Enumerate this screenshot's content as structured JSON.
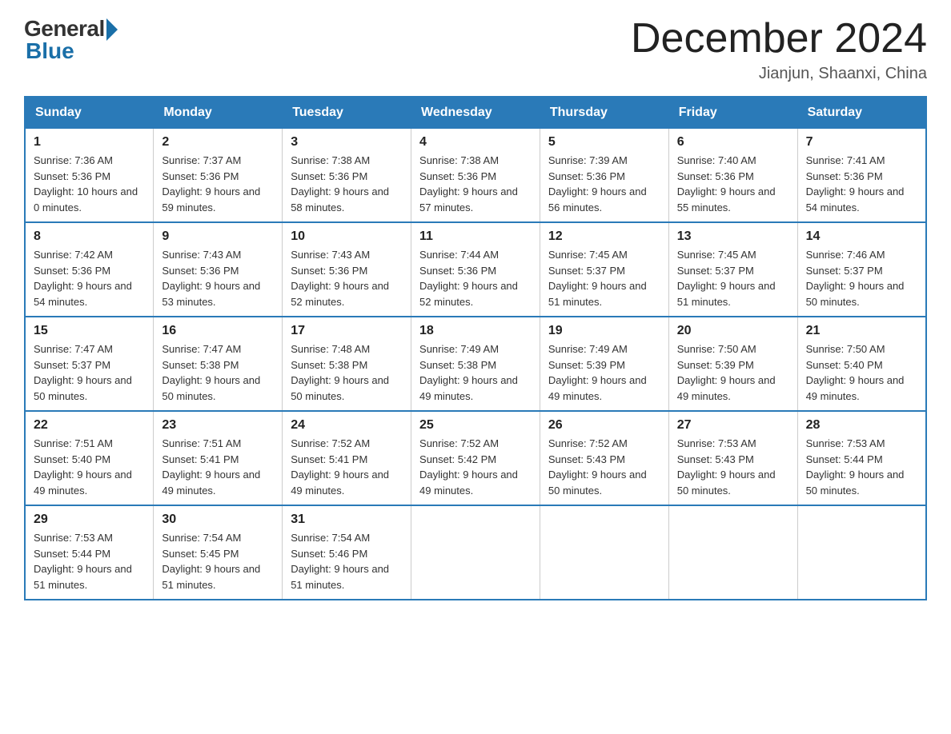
{
  "header": {
    "logo_general": "General",
    "logo_blue": "Blue",
    "month_title": "December 2024",
    "location": "Jianjun, Shaanxi, China"
  },
  "weekdays": [
    "Sunday",
    "Monday",
    "Tuesday",
    "Wednesday",
    "Thursday",
    "Friday",
    "Saturday"
  ],
  "weeks": [
    [
      {
        "day": "1",
        "sunrise": "7:36 AM",
        "sunset": "5:36 PM",
        "daylight": "10 hours and 0 minutes."
      },
      {
        "day": "2",
        "sunrise": "7:37 AM",
        "sunset": "5:36 PM",
        "daylight": "9 hours and 59 minutes."
      },
      {
        "day": "3",
        "sunrise": "7:38 AM",
        "sunset": "5:36 PM",
        "daylight": "9 hours and 58 minutes."
      },
      {
        "day": "4",
        "sunrise": "7:38 AM",
        "sunset": "5:36 PM",
        "daylight": "9 hours and 57 minutes."
      },
      {
        "day": "5",
        "sunrise": "7:39 AM",
        "sunset": "5:36 PM",
        "daylight": "9 hours and 56 minutes."
      },
      {
        "day": "6",
        "sunrise": "7:40 AM",
        "sunset": "5:36 PM",
        "daylight": "9 hours and 55 minutes."
      },
      {
        "day": "7",
        "sunrise": "7:41 AM",
        "sunset": "5:36 PM",
        "daylight": "9 hours and 54 minutes."
      }
    ],
    [
      {
        "day": "8",
        "sunrise": "7:42 AM",
        "sunset": "5:36 PM",
        "daylight": "9 hours and 54 minutes."
      },
      {
        "day": "9",
        "sunrise": "7:43 AM",
        "sunset": "5:36 PM",
        "daylight": "9 hours and 53 minutes."
      },
      {
        "day": "10",
        "sunrise": "7:43 AM",
        "sunset": "5:36 PM",
        "daylight": "9 hours and 52 minutes."
      },
      {
        "day": "11",
        "sunrise": "7:44 AM",
        "sunset": "5:36 PM",
        "daylight": "9 hours and 52 minutes."
      },
      {
        "day": "12",
        "sunrise": "7:45 AM",
        "sunset": "5:37 PM",
        "daylight": "9 hours and 51 minutes."
      },
      {
        "day": "13",
        "sunrise": "7:45 AM",
        "sunset": "5:37 PM",
        "daylight": "9 hours and 51 minutes."
      },
      {
        "day": "14",
        "sunrise": "7:46 AM",
        "sunset": "5:37 PM",
        "daylight": "9 hours and 50 minutes."
      }
    ],
    [
      {
        "day": "15",
        "sunrise": "7:47 AM",
        "sunset": "5:37 PM",
        "daylight": "9 hours and 50 minutes."
      },
      {
        "day": "16",
        "sunrise": "7:47 AM",
        "sunset": "5:38 PM",
        "daylight": "9 hours and 50 minutes."
      },
      {
        "day": "17",
        "sunrise": "7:48 AM",
        "sunset": "5:38 PM",
        "daylight": "9 hours and 50 minutes."
      },
      {
        "day": "18",
        "sunrise": "7:49 AM",
        "sunset": "5:38 PM",
        "daylight": "9 hours and 49 minutes."
      },
      {
        "day": "19",
        "sunrise": "7:49 AM",
        "sunset": "5:39 PM",
        "daylight": "9 hours and 49 minutes."
      },
      {
        "day": "20",
        "sunrise": "7:50 AM",
        "sunset": "5:39 PM",
        "daylight": "9 hours and 49 minutes."
      },
      {
        "day": "21",
        "sunrise": "7:50 AM",
        "sunset": "5:40 PM",
        "daylight": "9 hours and 49 minutes."
      }
    ],
    [
      {
        "day": "22",
        "sunrise": "7:51 AM",
        "sunset": "5:40 PM",
        "daylight": "9 hours and 49 minutes."
      },
      {
        "day": "23",
        "sunrise": "7:51 AM",
        "sunset": "5:41 PM",
        "daylight": "9 hours and 49 minutes."
      },
      {
        "day": "24",
        "sunrise": "7:52 AM",
        "sunset": "5:41 PM",
        "daylight": "9 hours and 49 minutes."
      },
      {
        "day": "25",
        "sunrise": "7:52 AM",
        "sunset": "5:42 PM",
        "daylight": "9 hours and 49 minutes."
      },
      {
        "day": "26",
        "sunrise": "7:52 AM",
        "sunset": "5:43 PM",
        "daylight": "9 hours and 50 minutes."
      },
      {
        "day": "27",
        "sunrise": "7:53 AM",
        "sunset": "5:43 PM",
        "daylight": "9 hours and 50 minutes."
      },
      {
        "day": "28",
        "sunrise": "7:53 AM",
        "sunset": "5:44 PM",
        "daylight": "9 hours and 50 minutes."
      }
    ],
    [
      {
        "day": "29",
        "sunrise": "7:53 AM",
        "sunset": "5:44 PM",
        "daylight": "9 hours and 51 minutes."
      },
      {
        "day": "30",
        "sunrise": "7:54 AM",
        "sunset": "5:45 PM",
        "daylight": "9 hours and 51 minutes."
      },
      {
        "day": "31",
        "sunrise": "7:54 AM",
        "sunset": "5:46 PM",
        "daylight": "9 hours and 51 minutes."
      },
      null,
      null,
      null,
      null
    ]
  ]
}
